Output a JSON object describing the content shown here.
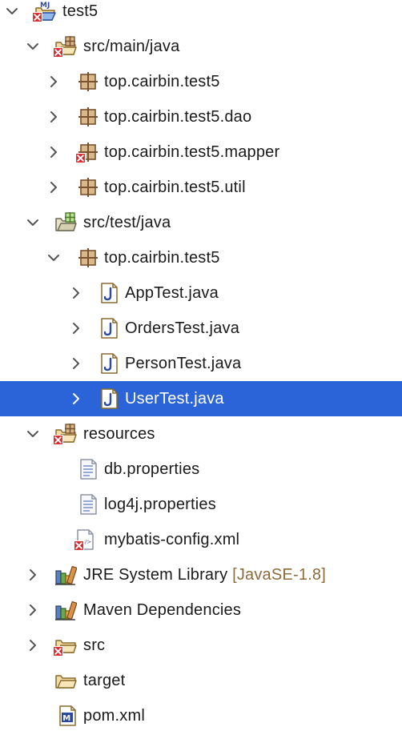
{
  "tree": {
    "project": {
      "label": "test5"
    },
    "src_main_java": {
      "label": "src/main/java",
      "packages": [
        {
          "label": "top.cairbin.test5"
        },
        {
          "label": "top.cairbin.test5.dao"
        },
        {
          "label": "top.cairbin.test5.mapper"
        },
        {
          "label": "top.cairbin.test5.util"
        }
      ]
    },
    "src_test_java": {
      "label": "src/test/java",
      "package": {
        "label": "top.cairbin.test5"
      },
      "files": [
        {
          "label": "AppTest.java"
        },
        {
          "label": "OrdersTest.java"
        },
        {
          "label": "PersonTest.java"
        },
        {
          "label": "UserTest.java",
          "selected": true
        }
      ]
    },
    "resources": {
      "label": "resources",
      "files": [
        {
          "label": "db.properties"
        },
        {
          "label": "log4j.properties"
        },
        {
          "label": "mybatis-config.xml"
        }
      ]
    },
    "jre": {
      "label": "JRE System Library",
      "decoration": "[JavaSE-1.8]"
    },
    "maven": {
      "label": "Maven Dependencies"
    },
    "src": {
      "label": "src"
    },
    "target": {
      "label": "target"
    },
    "pom": {
      "label": "pom.xml"
    }
  },
  "colors": {
    "selection": "#2a64d8",
    "decoration": "#8d6b3c",
    "chevron": "#444444"
  },
  "icons": {
    "expanded": "chevron-down-icon",
    "collapsed": "chevron-right-icon",
    "project": "java-project-icon",
    "source_folder": "source-folder-icon",
    "package": "package-icon",
    "java_file": "java-file-icon",
    "properties_file": "properties-file-icon",
    "xml_file": "xml-file-icon",
    "library": "library-icon",
    "folder": "folder-icon",
    "maven_file": "maven-pom-icon",
    "error_overlay": "error-overlay-icon"
  }
}
